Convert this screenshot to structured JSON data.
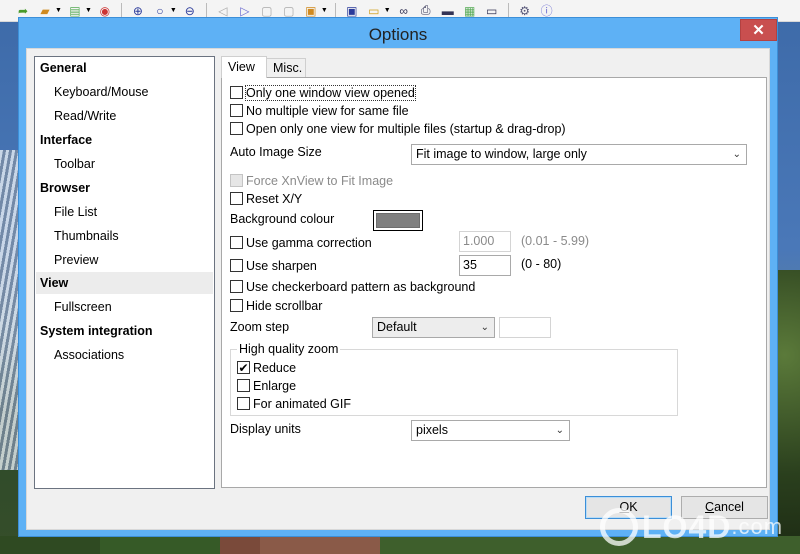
{
  "app_toolbar": {
    "icons": [
      "back-forward-icon",
      "open-folder-icon",
      "color-palette-icon",
      "eye-icon",
      "zoom-in-icon",
      "zoom-icon",
      "zoom-out-icon",
      "previous-icon",
      "next-icon",
      "first-page-icon",
      "last-page-icon",
      "image-edit-icon",
      "fit-window-icon",
      "slideshow-icon",
      "find-icon",
      "print-icon",
      "scanner-icon",
      "browser-icon",
      "window-icon",
      "settings-icon",
      "info-icon"
    ]
  },
  "dialog": {
    "title": "Options",
    "close_glyph": "✕"
  },
  "tree": {
    "items": [
      {
        "label": "General",
        "level": 0,
        "selected": false
      },
      {
        "label": "Keyboard/Mouse",
        "level": 1,
        "selected": false
      },
      {
        "label": "Read/Write",
        "level": 1,
        "selected": false
      },
      {
        "label": "Interface",
        "level": 0,
        "selected": false
      },
      {
        "label": "Toolbar",
        "level": 1,
        "selected": false
      },
      {
        "label": "Browser",
        "level": 0,
        "selected": false
      },
      {
        "label": "File List",
        "level": 1,
        "selected": false
      },
      {
        "label": "Thumbnails",
        "level": 1,
        "selected": false
      },
      {
        "label": "Preview",
        "level": 1,
        "selected": false
      },
      {
        "label": "View",
        "level": 0,
        "selected": true
      },
      {
        "label": "Fullscreen",
        "level": 1,
        "selected": false
      },
      {
        "label": "System integration",
        "level": 0,
        "selected": false
      },
      {
        "label": "Associations",
        "level": 1,
        "selected": false
      }
    ]
  },
  "tabs": [
    {
      "label": "View",
      "active": true
    },
    {
      "label": "Misc.",
      "active": false
    }
  ],
  "view": {
    "only_one_window": {
      "label": "Only one window view opened",
      "checked": false
    },
    "no_multiple_view": {
      "label": "No multiple view for same file",
      "checked": false
    },
    "open_only_one_view": {
      "label": "Open only one view for multiple files (startup & drag-drop)",
      "checked": false
    },
    "auto_image_size": {
      "label": "Auto Image Size",
      "value": "Fit image to window, large only"
    },
    "force_fit": {
      "label": "Force XnView to Fit Image",
      "checked": false,
      "disabled": true
    },
    "reset_xy": {
      "label": "Reset X/Y",
      "checked": false
    },
    "background_colour": {
      "label": "Background colour",
      "color": "#808080"
    },
    "gamma": {
      "label": "Use gamma correction",
      "checked": false,
      "value": "1.000",
      "range": "(0.01 - 5.99)"
    },
    "sharpen": {
      "label": "Use sharpen",
      "checked": false,
      "value": "35",
      "range": "(0 - 80)"
    },
    "checkerboard": {
      "label": "Use checkerboard pattern as background",
      "checked": false
    },
    "hide_scrollbar": {
      "label": "Hide scrollbar",
      "checked": false
    },
    "zoom_step": {
      "label": "Zoom step",
      "value": "Default",
      "extra_value": ""
    },
    "high_quality_zoom": {
      "title": "High quality zoom",
      "reduce": {
        "label": "Reduce",
        "checked": true
      },
      "enlarge": {
        "label": "Enlarge",
        "checked": false
      },
      "animated_gif": {
        "label": "For animated GIF",
        "checked": false
      }
    },
    "display_units": {
      "label": "Display units",
      "value": "pixels"
    }
  },
  "buttons": {
    "ok": {
      "accel": "O",
      "rest": "K"
    },
    "cancel": {
      "accel": "C",
      "rest": "ancel"
    }
  },
  "watermark": {
    "text": "LO4D",
    "suffix": ".com"
  },
  "glyphs": {
    "check": "✔",
    "chevron": "⌄"
  }
}
